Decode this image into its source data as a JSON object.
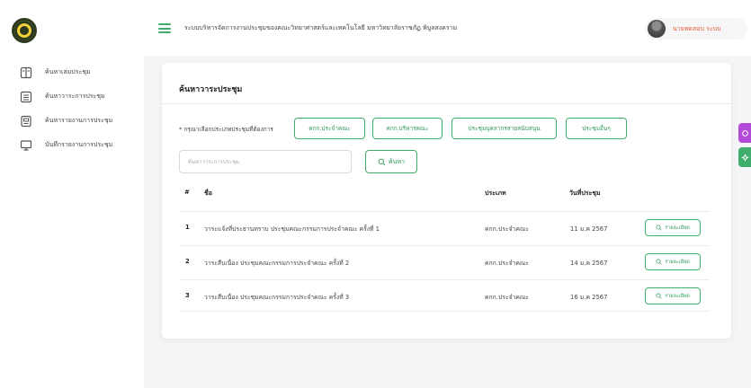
{
  "app": {
    "title": "ระบบบริหารจัดการงานประชุมของคณะวิทยาศาสตร์และเทคโนโลยี มหาวิทยาลัยราชภัฏ พิบูลสงคราม"
  },
  "user": {
    "name": "นายทดสอบ ระบบ"
  },
  "sidebar": {
    "items": [
      {
        "label": "ค้นหาเล่มประชุม",
        "icon": "book-icon"
      },
      {
        "label": "ค้นหาวาระการประชุม",
        "icon": "list-icon"
      },
      {
        "label": "ค้นหารายงานการประชุม",
        "icon": "document-icon"
      },
      {
        "label": "บันทึกรายงานการประชุม",
        "icon": "monitor-icon"
      }
    ]
  },
  "main": {
    "card_title": "ค้นหาวาระประชุม",
    "filter_label": "* กรุณาเลือกประเภทประชุมที่ต้องการ",
    "filters": [
      "คกก.ประจำคณะ",
      "คกก.บริหารคณะ",
      "ประชุมบุคลากรสายสนับสนุน",
      "ประชุมอื่นๆ"
    ],
    "search": {
      "placeholder": "ค้นหาวาระการประชุม",
      "button_label": "ค้นหา"
    },
    "table": {
      "headers": [
        "#",
        "ชื่อ",
        "ประเภท",
        "วันที่ประชุม"
      ],
      "rows": [
        {
          "num": "1",
          "name": "วาระแจ้งที่ประธานทราบ ประชุมคณะกรรมการประจำคณะ ครั้งที่ 1",
          "type": "คกก.ประจำคณะ",
          "date": "11 ม.ค 2567",
          "action": "รายละเอียด"
        },
        {
          "num": "2",
          "name": "วาระสืบเนื่อง ประชุมคณะกรรมการประจำคณะ ครั้งที่ 2",
          "type": "คกก.ประจำคณะ",
          "date": "14 ม.ค 2567",
          "action": "รายละเอียด"
        },
        {
          "num": "3",
          "name": "วาระสืบเนื่อง ประชุมคณะกรรมการประจำคณะ ครั้งที่ 3",
          "type": "คกก.ประจำคณะ",
          "date": "16 ม.ค 2567",
          "action": "รายละเอียด"
        }
      ]
    }
  },
  "colors": {
    "accent": "#3fae6c",
    "user_name": "#e25b3a",
    "float_tab_purple": "#b44ad8",
    "float_tab_green": "#3fae6c"
  }
}
